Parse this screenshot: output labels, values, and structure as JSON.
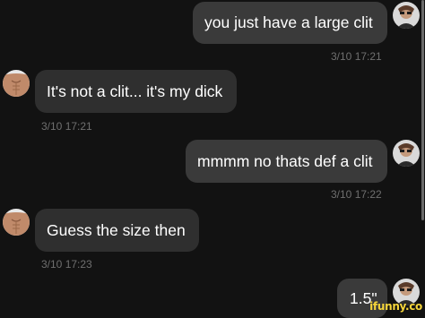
{
  "messages": [
    {
      "sender": "other-user",
      "text": "you just have a large clit",
      "timestamp": "3/10 17:21"
    },
    {
      "sender": "self",
      "text": "It's not a clit... it's my dick",
      "timestamp": "3/10 17:21"
    },
    {
      "sender": "other-user",
      "text": "mmmm no thats def a clit",
      "timestamp": "3/10 17:22"
    },
    {
      "sender": "self",
      "text": "Guess the size then",
      "timestamp": "3/10 17:23"
    },
    {
      "sender": "other-user",
      "text": "1.5\"",
      "timestamp": ""
    }
  ],
  "watermark": "ifunny.co",
  "colors": {
    "background": "#121212",
    "bubble": "#2f2f2f",
    "text": "#ffffff",
    "timestamp": "#6f6f6f",
    "watermark": "#f5d53a"
  }
}
